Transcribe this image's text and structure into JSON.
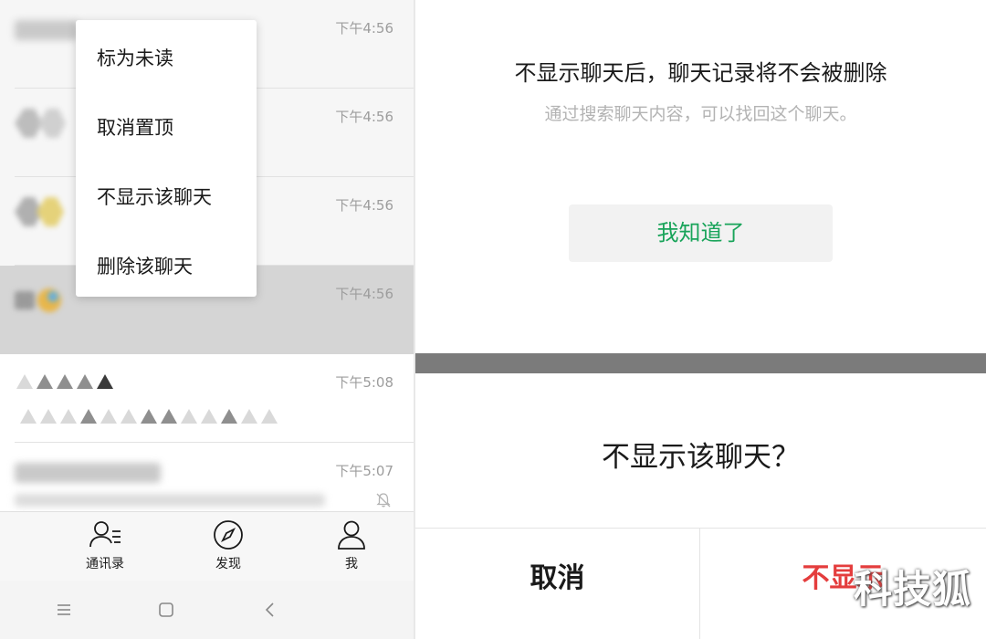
{
  "chat_list": {
    "rows": [
      {
        "time": "下午4:56"
      },
      {
        "time": "下午4:56"
      },
      {
        "time": "下午4:56"
      },
      {
        "time": "下午4:56"
      },
      {
        "time": "下午5:08"
      },
      {
        "time": "下午5:07"
      }
    ]
  },
  "context_menu": {
    "items": [
      "标为未读",
      "取消置顶",
      "不显示该聊天",
      "删除该聊天"
    ]
  },
  "tabbar": {
    "contacts_label": "通讯录",
    "discover_label": "发现",
    "me_label": "我"
  },
  "notice_dialog": {
    "title": "不显示聊天后，聊天记录将不会被删除",
    "subtitle": "通过搜索聊天内容，可以找回这个聊天。",
    "ack_label": "我知道了"
  },
  "confirm_dialog": {
    "title": "不显示该聊天？",
    "cancel_label": "取消",
    "confirm_label": "不显示"
  },
  "watermark": "科技狐",
  "colors": {
    "accent_green": "#19a45a",
    "danger_red": "#e43d3d"
  }
}
